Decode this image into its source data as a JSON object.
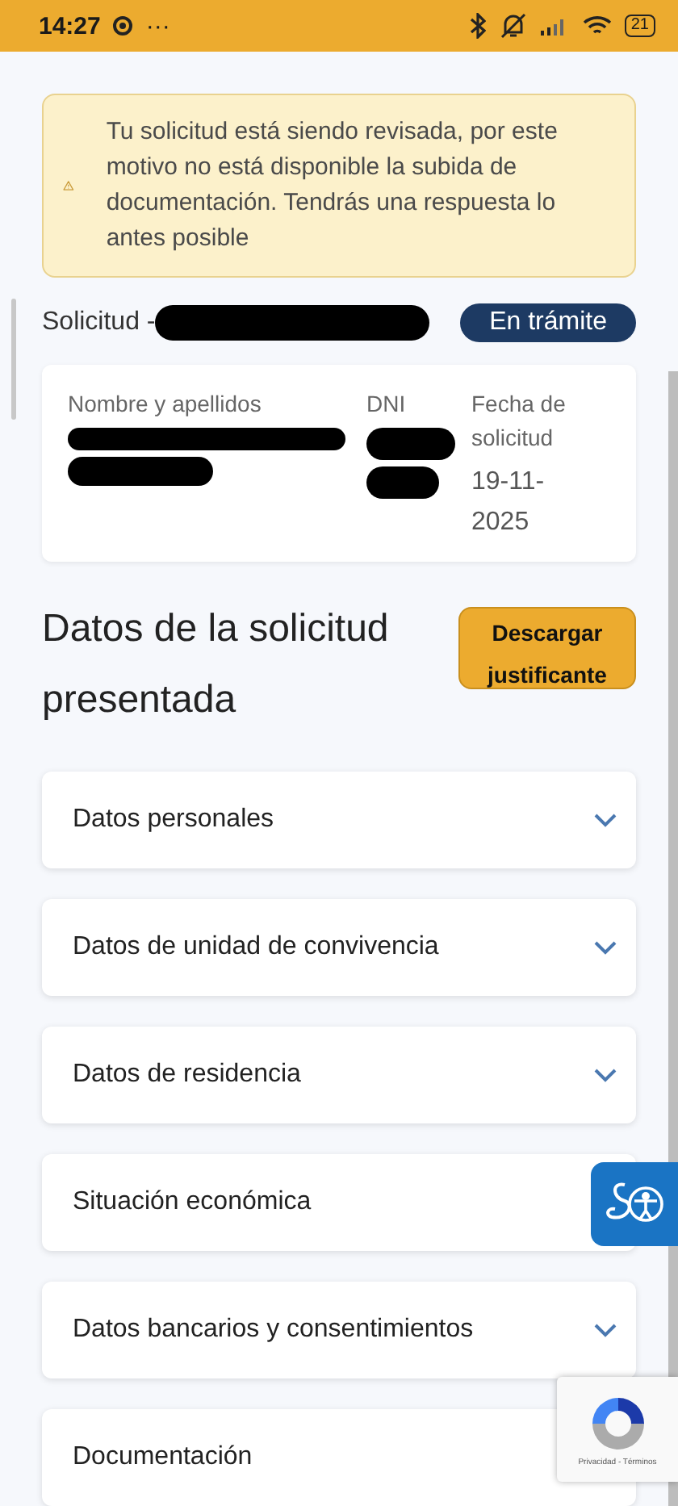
{
  "status_bar": {
    "time": "14:27",
    "more": "···",
    "battery": "21"
  },
  "alert": {
    "text": "Tu solicitud está siendo revisada, por este motivo no está disponible la subida de documentación. Tendrás una respuesta lo antes posible"
  },
  "request": {
    "label": "Solicitud -",
    "status": "En trámite"
  },
  "summary": {
    "columns": [
      {
        "header": "Nombre y apellidos"
      },
      {
        "header": "DNI"
      },
      {
        "header": "Fecha de solicitud",
        "value": "19-11-2025"
      }
    ]
  },
  "section": {
    "title": "Datos de la solicitud presentada",
    "button": "Descargar justificante"
  },
  "accordion": [
    {
      "label": "Datos personales",
      "expanded": false
    },
    {
      "label": "Datos de unidad de convivencia",
      "expanded": false
    },
    {
      "label": "Datos de residencia",
      "expanded": false
    },
    {
      "label": "Situación económica",
      "expanded": false,
      "chevron_covered": true
    },
    {
      "label": "Datos bancarios y consentimientos",
      "expanded": false
    },
    {
      "label": "Documentación",
      "expanded": false,
      "chevron_covered": true
    }
  ],
  "recaptcha": {
    "links": "Privacidad - Términos"
  }
}
